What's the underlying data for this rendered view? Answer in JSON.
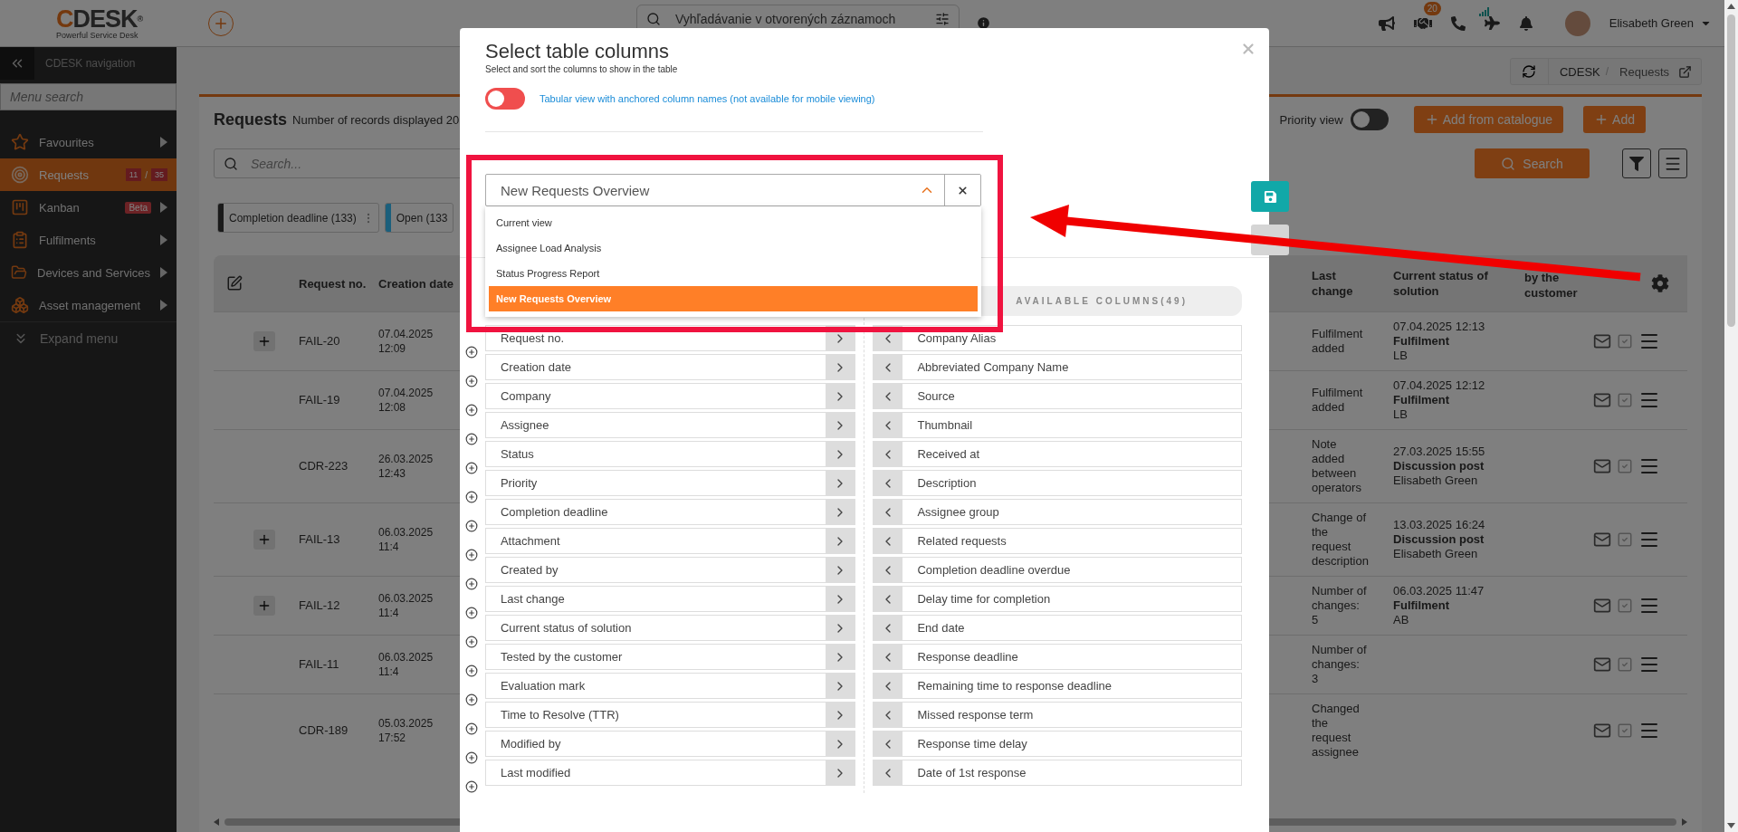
{
  "top_bar": {
    "logo": "CDESK",
    "logo_mark": "®",
    "tagline": "Powerful Service Desk",
    "search": {
      "placeholder": "Vyhľadávanie v otvorených záznamoch"
    },
    "notification_count": "20",
    "user_name": "Elisabeth Green"
  },
  "sidebar": {
    "title": "CDESK navigation",
    "search": {
      "placeholder": "Menu search"
    },
    "items": [
      {
        "label": "Favourites",
        "selected": false,
        "submenu": true
      },
      {
        "label": "Requests",
        "selected": true,
        "submenu": false,
        "counts": [
          "11",
          "35"
        ],
        "count_separator": "/"
      },
      {
        "label": "Kanban",
        "selected": false,
        "submenu": true,
        "badge": "Beta"
      },
      {
        "label": "Fulfilments",
        "selected": false,
        "submenu": true
      },
      {
        "label": "Devices and Services",
        "selected": false,
        "submenu": true
      },
      {
        "label": "Asset management",
        "selected": false,
        "submenu": true
      }
    ],
    "expand": "Expand menu"
  },
  "breadcrumb": [
    "CDESK",
    "Requests"
  ],
  "breadcrumb_separator": "/",
  "page": {
    "title": "Requests",
    "subtitle": "Number of records displayed 20",
    "priority_view": {
      "label": "Priority view",
      "on": false
    },
    "buttons": [
      "Add from catalogue",
      "Add"
    ],
    "search": {
      "placeholder": "Search..."
    },
    "search_button": "Search",
    "filters": [
      {
        "label": "Completion deadline (133)",
        "color": "#1a1a1a",
        "menu": true
      },
      {
        "label": "Open (133",
        "color": "#1b5f7c",
        "menu": false
      }
    ]
  },
  "table": {
    "columns": [
      "Request no.",
      "Creation date",
      "Last change",
      "Current status of solution",
      "by the customer"
    ],
    "rows": [
      {
        "expandable": true,
        "request_no": "FAIL-20",
        "creation_date": "07.04.2025 12:09",
        "last_change": "Fulfilment added",
        "status": {
          "date": "07.04.2025 12:13",
          "type": "Fulfilment",
          "author": "LB"
        }
      },
      {
        "expandable": false,
        "request_no": "FAIL-19",
        "creation_date": "07.04.2025 12:08",
        "last_change": "Fulfilment added",
        "status": {
          "date": "07.04.2025 12:12",
          "type": "Fulfilment",
          "author": "LB"
        }
      },
      {
        "expandable": false,
        "request_no": "CDR-223",
        "creation_date": "26.03.2025 12:43",
        "last_change": "Note added between operators",
        "status": {
          "date": "27.03.2025 15:55",
          "type": "Discussion post",
          "author": "Elisabeth Green"
        }
      },
      {
        "expandable": true,
        "request_no": "FAIL-13",
        "creation_date": "06.03.2025 11:4",
        "last_change": "Change of the request description",
        "status": {
          "date": "13.03.2025 16:24",
          "type": "Discussion post",
          "author": "Elisabeth Green"
        }
      },
      {
        "expandable": true,
        "request_no": "FAIL-12",
        "creation_date": "06.03.2025 11:4",
        "last_change": "Number of changes: 5",
        "status": {
          "date": "06.03.2025 11:47",
          "type": "Fulfilment",
          "author": "AB"
        }
      },
      {
        "expandable": false,
        "request_no": "FAIL-11",
        "creation_date": "06.03.2025 11:4",
        "last_change": "Number of changes: 3"
      },
      {
        "expandable": false,
        "request_no": "CDR-189",
        "creation_date": "05.03.2025 17:52",
        "last_change": "Changed the request assignee"
      }
    ]
  },
  "modal": {
    "title": "Select table columns",
    "subtitle": "Select and sort the columns to show in the table",
    "anchored_view": {
      "label": "Tabular view with anchored column names (not available for mobile viewing)",
      "on": false
    },
    "column_set": {
      "value": "New Requests Overview",
      "expanded": true,
      "options": [
        {
          "label": "Current view",
          "selected": false
        },
        {
          "label": "Assignee Load Analysis",
          "selected": false
        },
        {
          "label": "Status Progress Report",
          "selected": false
        },
        {
          "label": "New Requests Overview",
          "selected": true
        }
      ]
    },
    "selected_columns": [
      "Request no.",
      "Creation date",
      "Company",
      "Assignee",
      "Status",
      "Priority",
      "Completion deadline",
      "Attachment",
      "Created by",
      "Last change",
      "Current status of solution",
      "Tested by the customer",
      "Evaluation mark",
      "Time to Resolve (TTR)",
      "Modified by",
      "Last modified"
    ],
    "available_header": "AVAILABLE COLUMNS(49)",
    "available_columns": [
      "Company Alias",
      "Abbreviated Company Name",
      "Source",
      "Thumbnail",
      "Received at",
      "Description",
      "Assignee group",
      "Related requests",
      "Completion deadline overdue",
      "Delay time for completion",
      "End date",
      "Response deadline",
      "Remaining time to response deadline",
      "Missed response term",
      "Response time delay",
      "Date of 1st response"
    ]
  }
}
